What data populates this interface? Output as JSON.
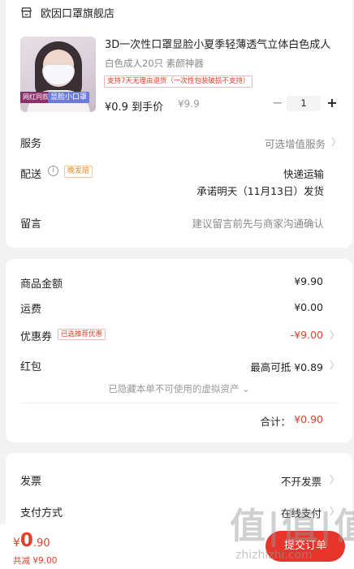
{
  "store": {
    "name": "欧因口罩旗舰店",
    "icon": "store-icon"
  },
  "product": {
    "title": "3D一次性口罩显脸小夏季轻薄透气立体白色成人",
    "spec": "白色成人20只 素颜神器",
    "return_tag": "支持7天无理由退货（一次性包装破损不支持）",
    "price_now": "¥0.9 到手价",
    "price_orig": "¥9.9",
    "quantity": "1",
    "qty_minus": "−",
    "qty_plus": "+",
    "thumb_tag_left": "网红同款",
    "thumb_tag_right": "显脸小口罩"
  },
  "service": {
    "label": "服务",
    "value": "可选增值服务"
  },
  "shipping": {
    "label": "配送",
    "info_icon": "ⓘ",
    "late_tag": "晚发赔",
    "method": "快递运输",
    "promise": "承诺明天（11月13日）发货"
  },
  "message": {
    "label": "留言",
    "placeholder": "建议留言前先与商家沟通确认"
  },
  "summary": {
    "amount_label": "商品金额",
    "amount": "¥9.90",
    "freight_label": "运费",
    "freight": "¥0.00",
    "coupon_label": "优惠券",
    "coupon_tag": "已选推荐优惠",
    "coupon": "-¥9.00",
    "redpacket_label": "红包",
    "redpacket": "最高可抵 ¥0.89",
    "hidden_assets": "已隐藏本单不可使用的虚拟资产 ⌄",
    "total_label": "合计：",
    "total": "¥0.90"
  },
  "invoice": {
    "label": "发票",
    "value": "不开发票"
  },
  "payment": {
    "label": "支付方式",
    "value": "在线支付"
  },
  "bottom": {
    "currency": "¥",
    "price_int": "0",
    "price_dec": ".90",
    "saved": "共减 ¥9.00",
    "submit": "提交订单"
  },
  "watermark": {
    "big": "值|值|值",
    "url": "zhizhizhi.com"
  },
  "colors": {
    "accent": "#e2402a",
    "button": "#e8352b",
    "tag_orange": "#e58a2a"
  }
}
